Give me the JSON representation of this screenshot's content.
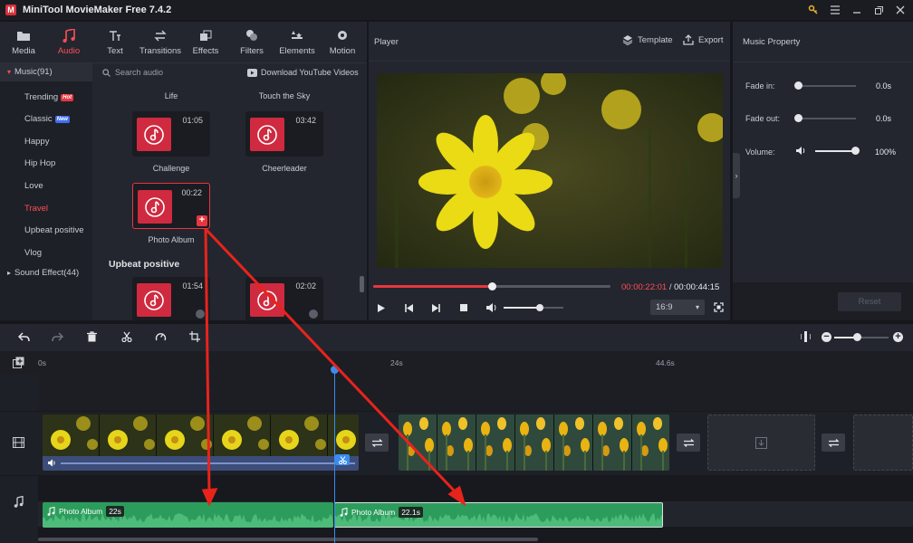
{
  "app": {
    "title": "MiniTool MovieMaker Free 7.4.2",
    "logo_letter": "M"
  },
  "tabs": [
    {
      "label": "Media",
      "icon": "media-folder-icon"
    },
    {
      "label": "Audio",
      "icon": "music-note-icon",
      "active": true
    },
    {
      "label": "Text",
      "icon": "text-icon"
    },
    {
      "label": "Transitions",
      "icon": "transitions-icon"
    },
    {
      "label": "Effects",
      "icon": "effects-icon"
    },
    {
      "label": "Filters",
      "icon": "filters-icon"
    },
    {
      "label": "Elements",
      "icon": "elements-icon"
    },
    {
      "label": "Motion",
      "icon": "motion-icon"
    }
  ],
  "categories": {
    "music_header": "Music(91)",
    "items": [
      {
        "label": "Trending",
        "badge": "Hot"
      },
      {
        "label": "Classic",
        "badge": "New"
      },
      {
        "label": "Happy"
      },
      {
        "label": "Hip Hop"
      },
      {
        "label": "Love"
      },
      {
        "label": "Travel",
        "selected": true
      },
      {
        "label": "Upbeat positive"
      },
      {
        "label": "Vlog"
      }
    ],
    "sound_effect_header": "Sound Effect(44)"
  },
  "audio": {
    "search_placeholder": "Search audio",
    "download_label": "Download YouTube Videos",
    "top_titles": [
      "Life",
      "Touch the Sky"
    ],
    "cards": [
      {
        "name": "Challenge",
        "duration": "01:05"
      },
      {
        "name": "Cheerleader",
        "duration": "03:42"
      },
      {
        "name": "Photo Album",
        "duration": "00:22"
      }
    ],
    "section_upbeat": "Upbeat positive",
    "upbeat_cards": [
      {
        "duration": "01:54"
      },
      {
        "duration": "02:02"
      }
    ]
  },
  "player": {
    "title": "Player",
    "template_label": "Template",
    "export_label": "Export",
    "current_time": "00:00:22:01",
    "separator": "/",
    "total_time": "00:00:44:15",
    "aspect": "16:9",
    "progress": 0.5,
    "volume": 0.6
  },
  "music_property": {
    "title": "Music Property",
    "fade_in_label": "Fade in:",
    "fade_in_value": "0.0s",
    "fade_out_label": "Fade out:",
    "fade_out_value": "0.0s",
    "volume_label": "Volume:",
    "volume_value": "100%",
    "reset_label": "Reset"
  },
  "timeline": {
    "ruler": [
      "0s",
      "24s",
      "44.6s"
    ],
    "audio_clips": [
      {
        "name": "Photo Album",
        "duration": "22s"
      },
      {
        "name": "Photo Album",
        "duration": "22.1s"
      }
    ]
  },
  "colors": {
    "accent": "#ff4d55",
    "audio_clip": "#2c9c5c",
    "playhead": "#3a8cf0",
    "annotation_arrow": "#e8231c"
  }
}
